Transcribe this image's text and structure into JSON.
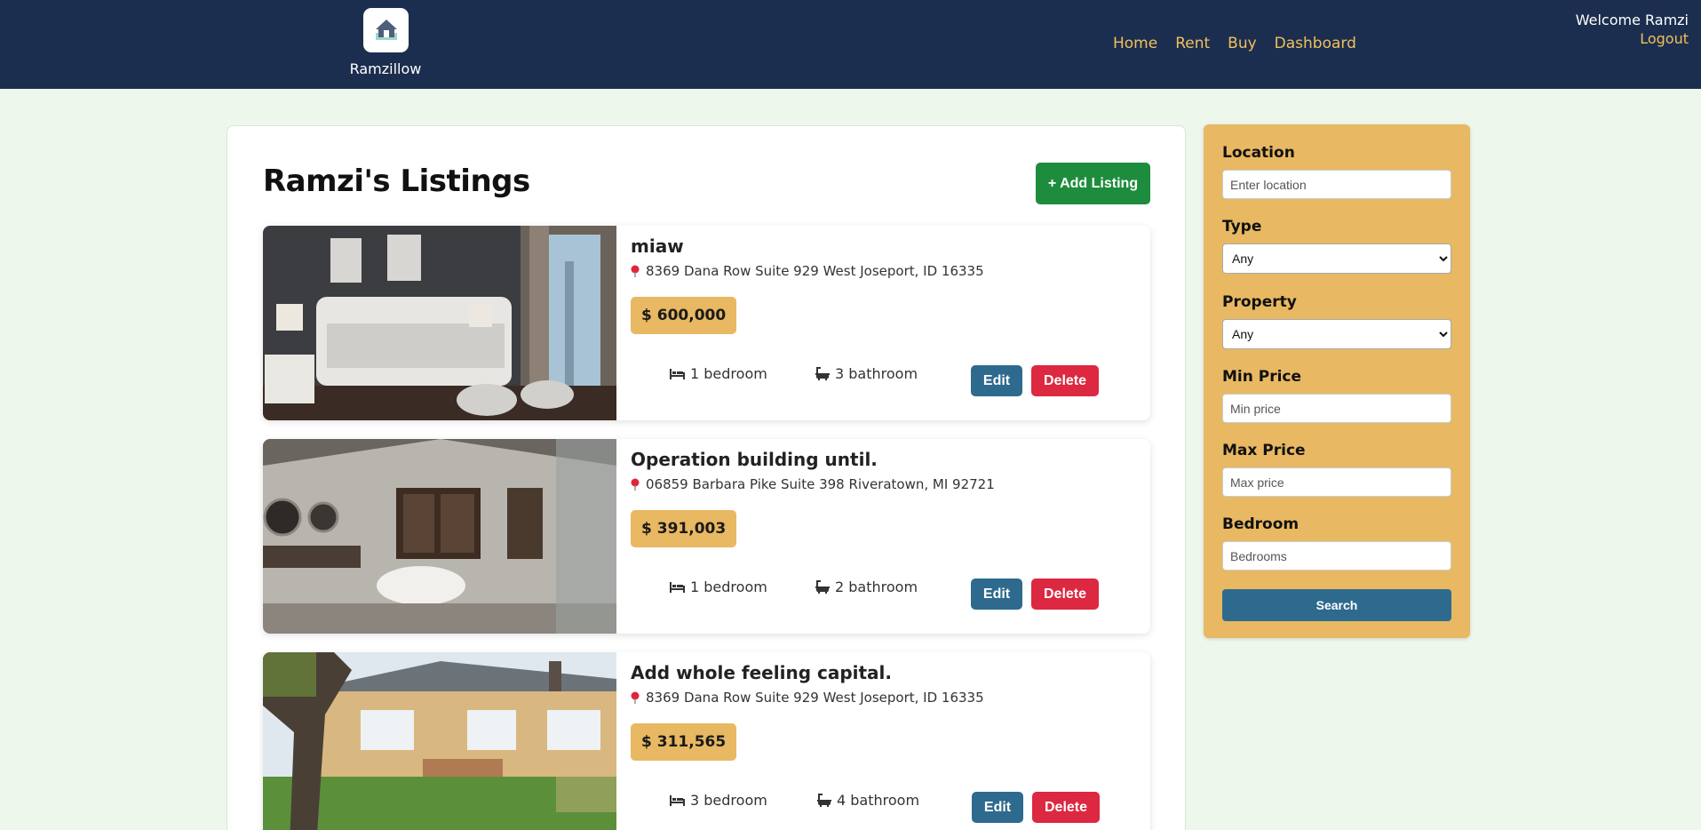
{
  "header": {
    "brand": "Ramzillow",
    "nav": [
      "Home",
      "Rent",
      "Buy",
      "Dashboard"
    ],
    "welcome": "Welcome Ramzi",
    "logout": "Logout"
  },
  "listings": {
    "title": "Ramzi's Listings",
    "add_label": "+ Add Listing",
    "edit_label": "Edit",
    "delete_label": "Delete",
    "items": [
      {
        "title": "miaw",
        "address": "8369 Dana Row Suite 929 West Joseport, ID 16335",
        "price": "$ 600,000",
        "bedrooms": "1 bedroom",
        "bathrooms": "3 bathroom",
        "image": "bedroom-photo"
      },
      {
        "title": "Operation building until.",
        "address": "06859 Barbara Pike Suite 398 Riveratown, MI 92721",
        "price": "$ 391,003",
        "bedrooms": "1 bedroom",
        "bathrooms": "2 bathroom",
        "image": "bathroom-photo"
      },
      {
        "title": "Add whole feeling capital.",
        "address": "8369 Dana Row Suite 929 West Joseport, ID 16335",
        "price": "$ 311,565",
        "bedrooms": "3 bedroom",
        "bathrooms": "4 bathroom",
        "image": "house-exterior-photo"
      }
    ]
  },
  "filters": {
    "location_label": "Location",
    "location_placeholder": "Enter location",
    "type_label": "Type",
    "type_value": "Any",
    "property_label": "Property",
    "property_value": "Any",
    "min_price_label": "Min Price",
    "min_price_placeholder": "Min price",
    "max_price_label": "Max Price",
    "max_price_placeholder": "Max price",
    "bedroom_label": "Bedroom",
    "bedroom_placeholder": "Bedrooms",
    "search_label": "Search"
  },
  "colors": {
    "header_bg": "#1c2e4f",
    "accent_gold": "#e8b862",
    "nav_link": "#f0c05c",
    "add_green": "#1e8c3d",
    "edit_blue": "#2e6a8e",
    "delete_red": "#dc2840",
    "page_bg": "#eef7ec"
  }
}
